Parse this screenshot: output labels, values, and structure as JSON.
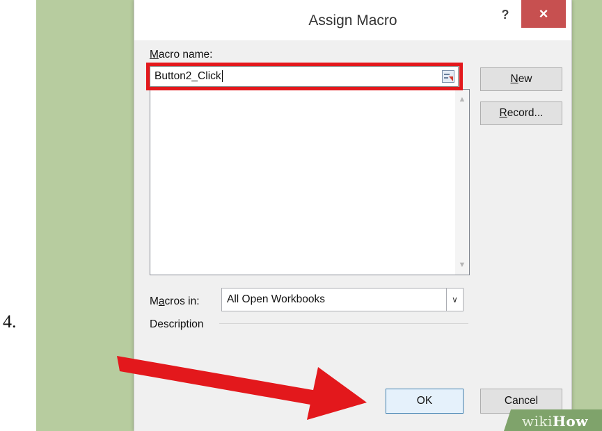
{
  "step_number": "4.",
  "dialog": {
    "title": "Assign Macro",
    "help_label": "?",
    "close_label": "×",
    "macro_name": {
      "label_hotkey": "M",
      "label_rest": "acro name:",
      "value": "Button2_Click"
    },
    "buttons": {
      "new_hotkey": "N",
      "new_rest": "ew",
      "record_hotkey": "R",
      "record_rest": "ecord...",
      "ok": "OK",
      "cancel": "Cancel"
    },
    "macros_in": {
      "label_first": "M",
      "label_hotkey": "a",
      "label_rest": "cros in:",
      "selected": "All Open Workbooks"
    },
    "description_label": "Description"
  },
  "watermark": {
    "part1": "wiki",
    "part2": "How"
  },
  "colors": {
    "background_frame": "#b7cc9f",
    "highlight_red": "#e3181c",
    "close_button": "#c75050",
    "watermark": "#7fa36b"
  },
  "icons": [
    "help-icon",
    "close-icon",
    "collapse-dialog-icon",
    "scroll-up-icon",
    "scroll-down-icon",
    "dropdown-chevron-icon",
    "annotation-arrow"
  ]
}
